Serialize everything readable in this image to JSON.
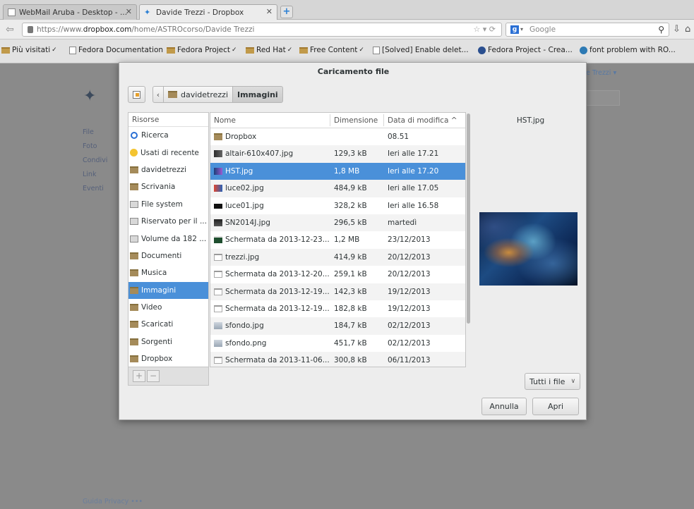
{
  "browser": {
    "tabs": [
      {
        "title": "WebMail Aruba - Desktop - ...",
        "close": "✕"
      },
      {
        "title": "Davide Trezzi - Dropbox",
        "close": "✕"
      }
    ],
    "new_tab": "+",
    "url_prefix": "https://www.",
    "url_domain": "dropbox.com",
    "url_path": "/home/ASTROcorso/Davide Trezzi",
    "search_placeholder": "Google",
    "search_engine_letter": "g",
    "bookmarks": [
      {
        "label": "Più visitati",
        "type": "folder",
        "menu": true
      },
      {
        "label": "Fedora Documentation",
        "type": "page",
        "menu": false
      },
      {
        "label": "Fedora Project",
        "type": "folder",
        "menu": true
      },
      {
        "label": "Red Hat",
        "type": "folder",
        "menu": true
      },
      {
        "label": "Free Content",
        "type": "folder",
        "menu": true
      },
      {
        "label": "[Solved] Enable delet...",
        "type": "page",
        "menu": false
      },
      {
        "label": "Fedora Project - Crea...",
        "type": "fedora",
        "menu": false
      },
      {
        "label": "font problem with RO...",
        "type": "wordpress",
        "menu": false
      }
    ]
  },
  "background_page": {
    "sidebar": [
      "File",
      "Foto",
      "Condivi",
      "Link",
      "Eventi"
    ],
    "user_menu": "e Trezzi ▾",
    "footer": "Guida   Privacy   •••"
  },
  "dialog": {
    "title": "Caricamento file",
    "path": [
      {
        "label": "davidetrezzi",
        "current": false
      },
      {
        "label": "Immagini",
        "current": true
      }
    ],
    "places_header": "Risorse",
    "places": [
      {
        "label": "Ricerca",
        "icon": "search-icon"
      },
      {
        "label": "Usati di recente",
        "icon": "recent-icon"
      },
      {
        "label": "davidetrezzi",
        "icon": "folder-icon"
      },
      {
        "label": "Scrivania",
        "icon": "folder-icon"
      },
      {
        "label": "File system",
        "icon": "drive-icon"
      },
      {
        "label": "Riservato per il ...",
        "icon": "drive-icon"
      },
      {
        "label": "Volume da 182 ...",
        "icon": "drive-icon"
      },
      {
        "label": "Documenti",
        "icon": "folder-icon"
      },
      {
        "label": "Musica",
        "icon": "folder-icon"
      },
      {
        "label": "Immagini",
        "icon": "folder-icon",
        "selected": true
      },
      {
        "label": "Video",
        "icon": "folder-icon"
      },
      {
        "label": "Scaricati",
        "icon": "folder-icon"
      },
      {
        "label": "Sorgenti",
        "icon": "folder-icon"
      },
      {
        "label": "Dropbox",
        "icon": "folder-icon"
      }
    ],
    "add_place": "+",
    "remove_place": "−",
    "columns": {
      "name": "Nome",
      "size": "Dimensione",
      "modified": "Data di modifica ^"
    },
    "files": [
      {
        "name": "Dropbox",
        "size": "",
        "modified": "08.51",
        "icon": "folder"
      },
      {
        "name": "altair-610x407.jpg",
        "size": "129,3 kB",
        "modified": "Ieri alle 17.21",
        "icon": "img1"
      },
      {
        "name": "HST.jpg",
        "size": "1,8 MB",
        "modified": "Ieri alle 17.20",
        "icon": "img2",
        "selected": true
      },
      {
        "name": "luce02.jpg",
        "size": "484,9 kB",
        "modified": "Ieri alle 17.05",
        "icon": "img3"
      },
      {
        "name": "luce01.jpg",
        "size": "328,2 kB",
        "modified": "Ieri alle 16.58",
        "icon": "img4"
      },
      {
        "name": "SN2014J.jpg",
        "size": "296,5 kB",
        "modified": "martedì",
        "icon": "img5"
      },
      {
        "name": "Schermata da 2013-12-23...",
        "size": "1,2 MB",
        "modified": "23/12/2013",
        "icon": "img6"
      },
      {
        "name": "trezzi.jpg",
        "size": "414,9 kB",
        "modified": "20/12/2013",
        "icon": "doc"
      },
      {
        "name": "Schermata da 2013-12-20...",
        "size": "259,1 kB",
        "modified": "20/12/2013",
        "icon": "doc"
      },
      {
        "name": "Schermata da 2013-12-19...",
        "size": "142,3 kB",
        "modified": "19/12/2013",
        "icon": "doc"
      },
      {
        "name": "Schermata da 2013-12-19...",
        "size": "182,8 kB",
        "modified": "19/12/2013",
        "icon": "doc"
      },
      {
        "name": "sfondo.jpg",
        "size": "184,7 kB",
        "modified": "02/12/2013",
        "icon": "sfondo"
      },
      {
        "name": "sfondo.png",
        "size": "451,7 kB",
        "modified": "02/12/2013",
        "icon": "sfondo"
      },
      {
        "name": "Schermata da 2013-11-06...",
        "size": "300,8 kB",
        "modified": "06/11/2013",
        "icon": "doc"
      }
    ],
    "preview_name": "HST.jpg",
    "filter_label": "Tutti i file",
    "cancel_label": "Annulla",
    "open_label": "Apri"
  }
}
